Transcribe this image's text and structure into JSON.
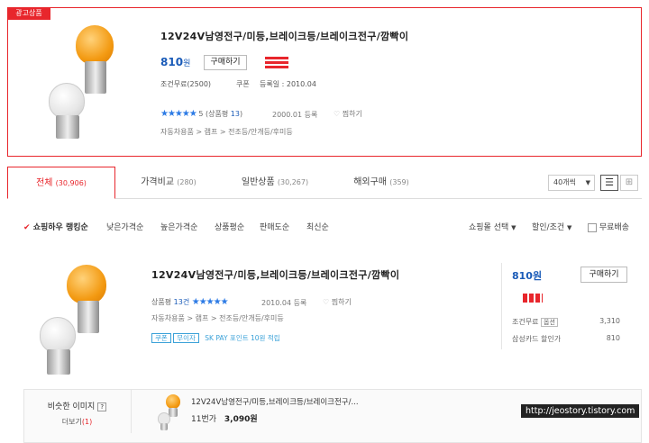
{
  "ad_product": {
    "badge": "광고상품",
    "title": "12V24V남영전구/미등,브레이크등/브레이크전구/깜빡이",
    "price": "810",
    "price_unit": "원",
    "buy_label": "구매하기",
    "shipping": "조건무료(2500)",
    "coupon": "쿠폰",
    "reg_date": "등록일 : 2010.04",
    "stars": "★★★★★",
    "rating": "5",
    "review_label": "(상품평",
    "review_count": "13",
    "review_close": ")",
    "registered": "2000.01 등록",
    "wish": "찜하기",
    "category": "자동차용품 > 램프 > 전조등/안개등/후미등"
  },
  "tabs": [
    {
      "label": "전체",
      "count": "(30,906)"
    },
    {
      "label": "가격비교",
      "count": "(280)"
    },
    {
      "label": "일반상품",
      "count": "(30,267)"
    },
    {
      "label": "해외구매",
      "count": "(359)"
    }
  ],
  "view_select": "40개씩",
  "sort_options": [
    "쇼핑하우 랭킹순",
    "낮은가격순",
    "높은가격순",
    "상품평순",
    "판매도순",
    "최신순"
  ],
  "filters": {
    "shop": "쇼핑몰 선택",
    "discount": "할인/조건",
    "free_ship": "무료배송"
  },
  "product": {
    "title": "12V24V남영전구/미등,브레이크등/브레이크전구/깜빡이",
    "price": "810원",
    "buy_label": "구매하기",
    "review_label": "상품평",
    "review_count": "13건",
    "stars": "★★★★★",
    "registered": "2010.04 등록",
    "wish": "찜하기",
    "category": "자동차용품 > 램프 > 전조등/안개등/후미등",
    "tag_coupon": "쿠폰",
    "tag_free": "무이자",
    "sk_pay": "SK PAY 포인트 10원 적립",
    "shipping_label": "조건무료",
    "shipping_tag": "옵션",
    "shipping_value": "3,310",
    "card_label": "삼성카드 할인가",
    "card_value": "810"
  },
  "similar": {
    "label": "비슷한 이미지",
    "help": "?",
    "more": "더보기",
    "more_count": "(1)",
    "item_title": "12V24V남영전구/미등,브레이크등/브레이크전구/...",
    "item_sellers": "11번가",
    "item_price": "3,090원"
  },
  "watermark": "http://jeostory.tistory.com",
  "colors": {
    "accent_red": "#e8262c",
    "link_blue": "#1a5bb8",
    "price_blue": "#1a5bb8",
    "star_blue": "#2d7be5"
  }
}
